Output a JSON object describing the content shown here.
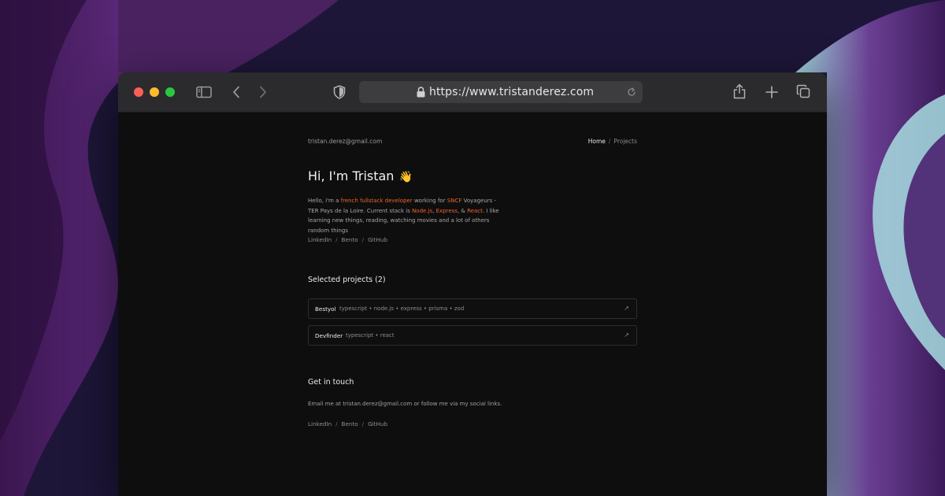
{
  "colors": {
    "accent": "#f0642a",
    "page_bg": "#0e0e0e",
    "toolbar_bg": "#2b2b2d"
  },
  "browser": {
    "url": "https://www.tristanderez.com",
    "icons": {
      "sidebar": "sidebar-icon",
      "back": "chevron-left-icon",
      "forward": "chevron-right-icon",
      "privacy": "shield-icon",
      "lock": "lock-icon",
      "reload": "reload-icon",
      "share": "share-icon",
      "new_tab": "plus-icon",
      "tabs": "tabs-overview-icon"
    }
  },
  "site": {
    "email": "tristan.derez@gmail.com",
    "nav": {
      "home": "Home",
      "separator": "/",
      "projects": "Projects"
    },
    "greeting": "Hi, I'm Tristan",
    "greeting_emoji": "👋",
    "bio": {
      "p1": "Hello, i'm a ",
      "role": "french fullstack developer",
      "p2": " working for ",
      "company": "SNCF",
      "p3": " Voyageurs - TER Pays de la Loire. Current stack is ",
      "tech1": "Node.js",
      "p4": ", ",
      "tech2": "Express",
      "p5": ", & ",
      "tech3": "React",
      "p6": ". I like learning new things, reading, watching movies and a lot of others random things"
    },
    "social": {
      "linkedin": "LinkedIn",
      "bento": "Bento",
      "github": "GitHub",
      "separator": "/"
    },
    "projects_title": "Selected projects (2)",
    "projects": [
      {
        "name": "Bestyol",
        "tags": "typescript • node.js • express • prisma • zod",
        "arrow": "↗"
      },
      {
        "name": "Devfinder",
        "tags": "typescript • react",
        "arrow": "↗"
      }
    ],
    "contact_title": "Get in touch",
    "contact_text": "Email me at tristan.derez@gmail.com or follow me via my social links."
  }
}
